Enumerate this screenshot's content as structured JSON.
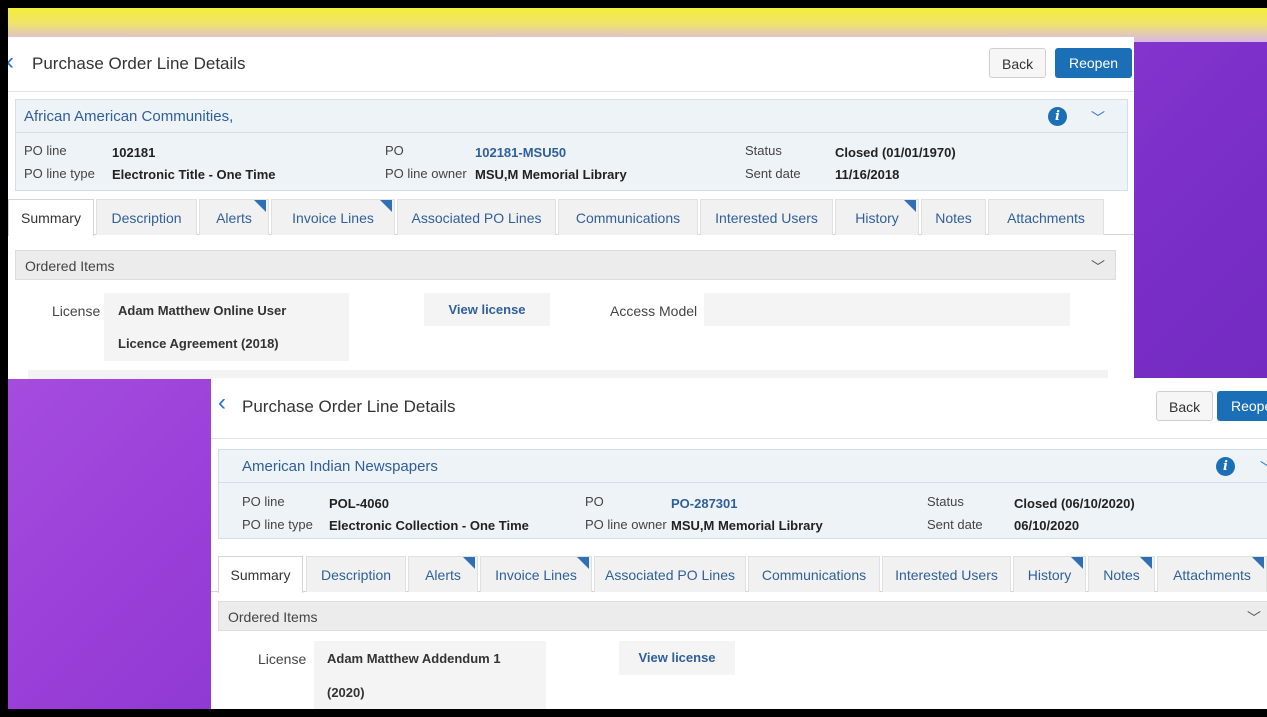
{
  "panels": [
    {
      "title": "Purchase Order Line Details",
      "back_label": "Back",
      "reopen_label": "Reopen",
      "item_title": "African American Communities,",
      "labels": {
        "po_line": "PO line",
        "po_line_type": "PO line type",
        "po": "PO",
        "po_line_owner": "PO line owner",
        "status": "Status",
        "sent_date": "Sent date"
      },
      "po_line": "102181",
      "po_line_type": "Electronic Title - One Time",
      "po": "102181-MSU50",
      "po_line_owner": "MSU,M Memorial Library",
      "status": "Closed (01/01/1970)",
      "sent_date": "11/16/2018",
      "tabs": [
        "Summary",
        "Description",
        "Alerts",
        "Invoice Lines",
        "Associated PO Lines",
        "Communications",
        "Interested Users",
        "History",
        "Notes",
        "Attachments"
      ],
      "ordered_items": "Ordered Items",
      "license_label": "License",
      "license_line1": "Adam Matthew Online User",
      "license_line2": "Licence Agreement (2018)",
      "view_license": "View license",
      "access_model_label": "Access Model"
    },
    {
      "title": "Purchase Order Line Details",
      "back_label": "Back",
      "reopen_label": "Reope",
      "item_title": "American Indian Newspapers",
      "labels": {
        "po_line": "PO line",
        "po_line_type": "PO line type",
        "po": "PO",
        "po_line_owner": "PO line owner",
        "status": "Status",
        "sent_date": "Sent date"
      },
      "po_line": "POL-4060",
      "po_line_type": "Electronic Collection - One Time",
      "po": "PO-287301",
      "po_line_owner": "MSU,M Memorial Library",
      "status": "Closed (06/10/2020)",
      "sent_date": "06/10/2020",
      "tabs": [
        "Summary",
        "Description",
        "Alerts",
        "Invoice Lines",
        "Associated PO Lines",
        "Communications",
        "Interested Users",
        "History",
        "Notes",
        "Attachments"
      ],
      "ordered_items": "Ordered Items",
      "license_label": "License",
      "license_line1": "Adam Matthew Addendum 1",
      "license_line2": "(2020)",
      "view_license": "View license"
    }
  ],
  "colors": {
    "accent_blue": "#1b6fb6",
    "link_blue": "#2f5f99",
    "slide_purple": "#8f38d0",
    "banner_yellow": "#f4ee3a"
  }
}
